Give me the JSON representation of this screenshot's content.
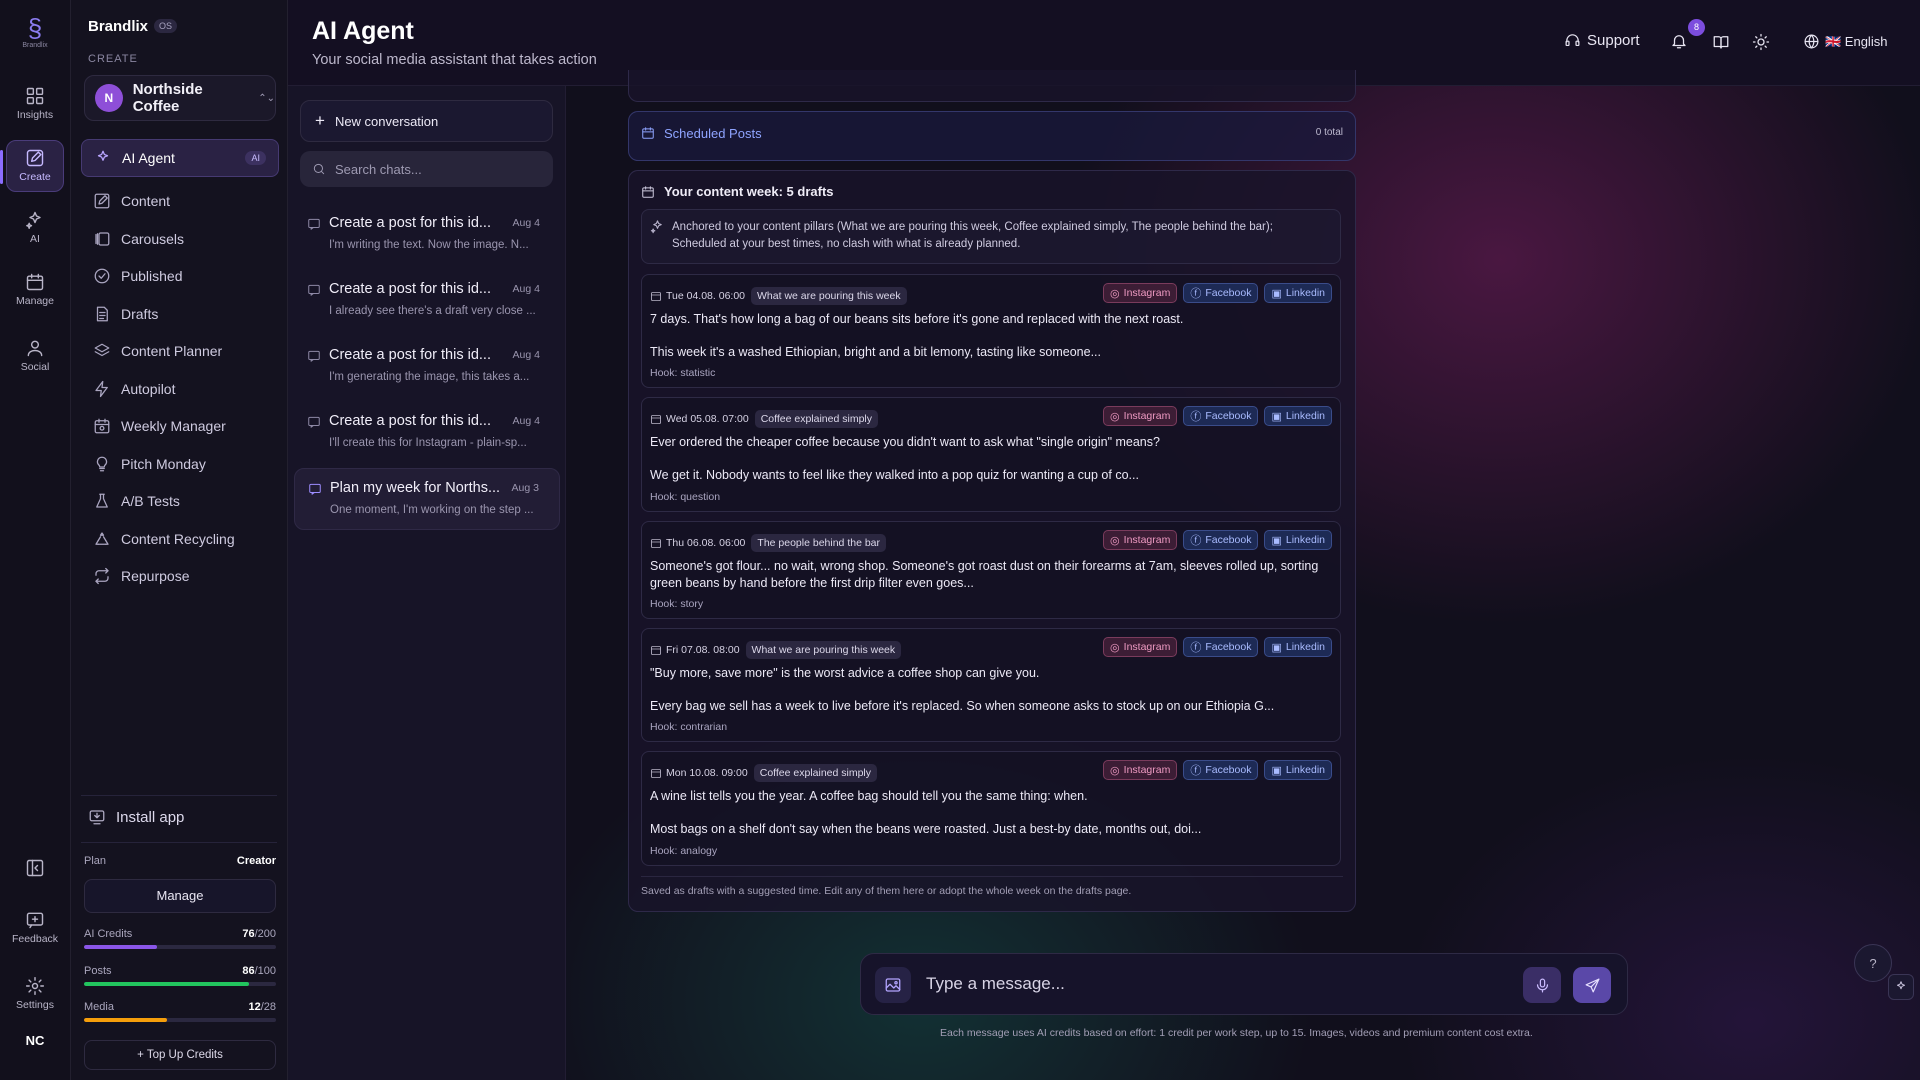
{
  "rail": {
    "logo_text": "Brandlix",
    "items": [
      {
        "label": "Insights",
        "icon": "grid-icon"
      },
      {
        "label": "Create",
        "icon": "edit-icon"
      },
      {
        "label": "AI",
        "icon": "sparkles-icon"
      },
      {
        "label": "Manage",
        "icon": "calendar-icon"
      },
      {
        "label": "Social",
        "icon": "users-icon"
      }
    ],
    "bottom": [
      {
        "label": "",
        "icon": "collapse-sidebar-icon"
      },
      {
        "label": "Feedback",
        "icon": "feedback-icon"
      },
      {
        "label": "Settings",
        "icon": "settings-icon"
      }
    ],
    "user_initials": "NC"
  },
  "sidebar": {
    "brand": "Brandlix",
    "brand_tag": "OS",
    "section": "CREATE",
    "workspace": {
      "initial": "N",
      "name": "Northside Coffee"
    },
    "items": [
      {
        "label": "AI Agent",
        "icon": "sparkles-icon",
        "tag": "AI"
      },
      {
        "label": "Content",
        "icon": "pencil-icon"
      },
      {
        "label": "Carousels",
        "icon": "carousel-icon"
      },
      {
        "label": "Published",
        "icon": "check-circle-icon"
      },
      {
        "label": "Drafts",
        "icon": "document-icon"
      },
      {
        "label": "Content Planner",
        "icon": "layers-icon"
      },
      {
        "label": "Autopilot",
        "icon": "bolt-icon"
      },
      {
        "label": "Weekly Manager",
        "icon": "calendar-clock-icon"
      },
      {
        "label": "Pitch Monday",
        "icon": "lightbulb-icon"
      },
      {
        "label": "A/B Tests",
        "icon": "flask-icon"
      },
      {
        "label": "Content Recycling",
        "icon": "recycle-icon"
      },
      {
        "label": "Repurpose",
        "icon": "repeat-icon"
      }
    ],
    "install": "Install app",
    "plan_label": "Plan",
    "plan_value": "Creator",
    "manage": "Manage",
    "meters": [
      {
        "label": "AI Credits",
        "used": "76",
        "total": "/200",
        "fraction": 0.38,
        "color": "#8a56e8"
      },
      {
        "label": "Posts",
        "used": "86",
        "total": "/100",
        "fraction": 0.86,
        "color": "#22c55e"
      },
      {
        "label": "Media",
        "used": "12",
        "total": "/28",
        "fraction": 0.43,
        "color": "#f59e0b"
      }
    ],
    "topup": "+ Top Up Credits"
  },
  "header": {
    "title": "AI Agent",
    "subtitle": "Your social media assistant that takes action",
    "support": "Support",
    "notifications": "8",
    "language": "🇬🇧 English"
  },
  "chats": {
    "new": "New conversation",
    "search_placeholder": "Search chats...",
    "items": [
      {
        "title": "Create a post for this id...",
        "date": "Aug 4",
        "preview": "I'm writing the text. Now the image. N..."
      },
      {
        "title": "Create a post for this id...",
        "date": "Aug 4",
        "preview": "I already see there's a draft very close ..."
      },
      {
        "title": "Create a post for this id...",
        "date": "Aug 4",
        "preview": "I'm generating the image, this takes a..."
      },
      {
        "title": "Create a post for this id...",
        "date": "Aug 4",
        "preview": "I'll create this for Instagram - plain-sp..."
      },
      {
        "title": "Plan my week for Norths...",
        "date": "Aug 3",
        "preview": "One moment, I'm working on the step ..."
      }
    ]
  },
  "scheduled": {
    "title": "Scheduled Posts",
    "total": "0 total"
  },
  "week": {
    "title": "Your content week: 5 drafts",
    "anchor": "Anchored to your content pillars (What we are pouring this week, Coffee explained simply, The people behind the bar); Scheduled at your best times, no clash with what is already planned.",
    "networks": {
      "ig": "Instagram",
      "fb": "Facebook",
      "li": "Linkedin"
    },
    "posts": [
      {
        "date": "Tue 04.08. 06:00",
        "pillar": "What we are pouring this week",
        "text1": "7 days. That's how long a bag of our beans sits before it's gone and replaced with the next roast.",
        "text2": "This week it's a washed Ethiopian, bright and a bit lemony, tasting like someone...",
        "hook": "Hook: statistic"
      },
      {
        "date": "Wed 05.08. 07:00",
        "pillar": "Coffee explained simply",
        "text1": "Ever ordered the cheaper coffee because you didn't want to ask what \"single origin\" means?",
        "text2": "We get it. Nobody wants to feel like they walked into a pop quiz for wanting a cup of co...",
        "hook": "Hook: question"
      },
      {
        "date": "Thu 06.08. 06:00",
        "pillar": "The people behind the bar",
        "text1": "Someone's got flour... no wait, wrong shop. Someone's got roast dust on their forearms at 7am, sleeves rolled up, sorting green beans by hand before the first drip filter even goes...",
        "text2": "",
        "hook": "Hook: story"
      },
      {
        "date": "Fri 07.08. 08:00",
        "pillar": "What we are pouring this week",
        "text1": "\"Buy more, save more\" is the worst advice a coffee shop can give you.",
        "text2": "Every bag we sell has a week to live before it's replaced. So when someone asks to stock up on our Ethiopia G...",
        "hook": "Hook: contrarian"
      },
      {
        "date": "Mon 10.08. 09:00",
        "pillar": "Coffee explained simply",
        "text1": "A wine list tells you the year. A coffee bag should tell you the same thing: when.",
        "text2": "Most bags on a shelf don't say when the beans were roasted. Just a best-by date, months out, doi...",
        "hook": "Hook: analogy"
      }
    ],
    "footnote": "Saved as drafts with a suggested time. Edit any of them here or adopt the whole week on the drafts page."
  },
  "composer": {
    "placeholder": "Type a message...",
    "note": "Each message uses AI credits based on effort: 1 credit per work step, up to 15. Images, videos and premium content cost extra."
  }
}
